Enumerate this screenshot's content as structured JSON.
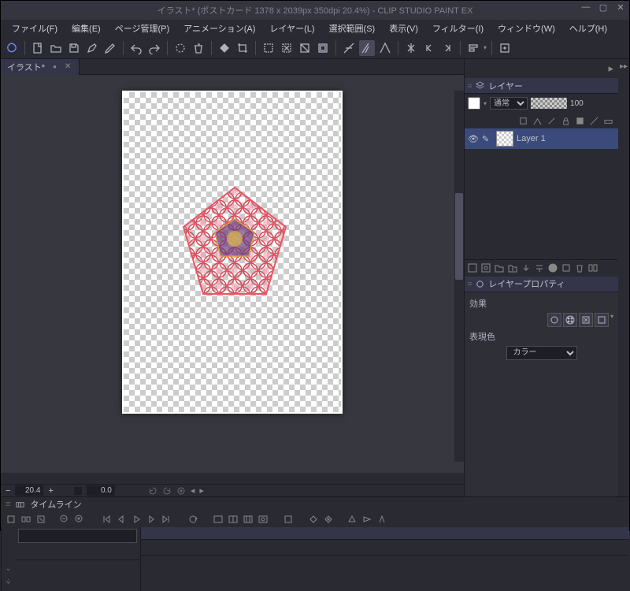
{
  "title": "イラスト* (ポストカード 1378 x 2039px 350dpi 20.4%)   - CLIP STUDIO PAINT EX",
  "menu": [
    "ファイル(F)",
    "編集(E)",
    "ページ管理(P)",
    "アニメーション(A)",
    "レイヤー(L)",
    "選択範囲(S)",
    "表示(V)",
    "フィルター(I)",
    "ウィンドウ(W)",
    "ヘルプ(H)"
  ],
  "doc_tab": {
    "label": "イラスト*"
  },
  "status": {
    "zoom": "20.4",
    "rotation": "0.0"
  },
  "layer_panel": {
    "title": "レイヤー",
    "blend_mode": "通常",
    "opacity": "100",
    "layers": [
      {
        "name": "Layer 1",
        "visible": true,
        "selected": true
      }
    ]
  },
  "layer_prop": {
    "title": "レイヤープロパティ",
    "effect_label": "効果",
    "color_label": "表現色",
    "color_mode": "カラー"
  },
  "timeline": {
    "title": "タイムライン"
  }
}
